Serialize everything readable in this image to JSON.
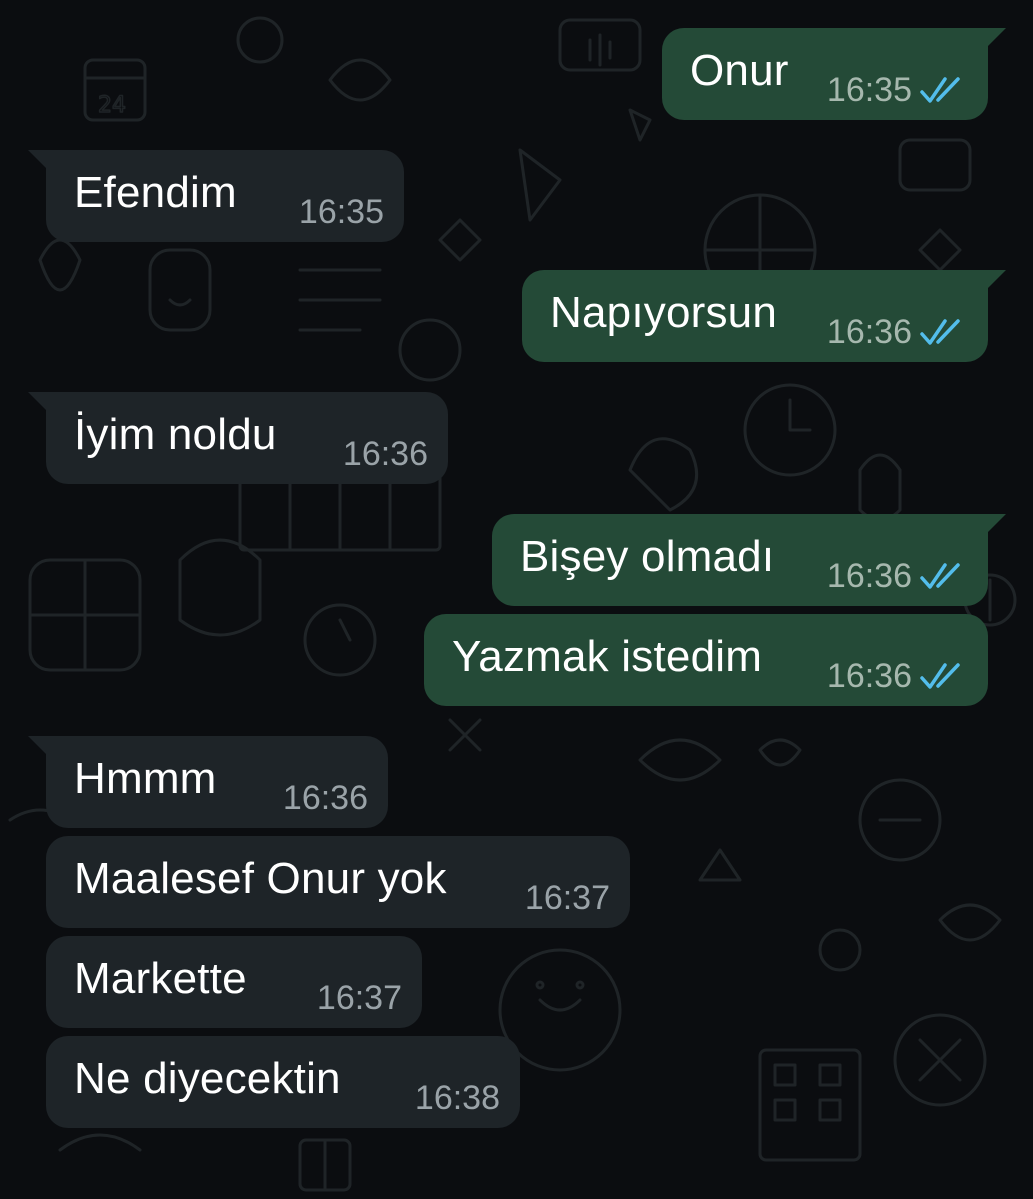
{
  "colors": {
    "background": "#0b0d10",
    "outgoing_bubble": "#244a37",
    "incoming_bubble": "#1e2428",
    "read_check": "#53bdeb",
    "timestamp": "#9aa3a8"
  },
  "messages": [
    {
      "direction": "outgoing",
      "text": "Onur",
      "time": "16:35",
      "status": "read",
      "status_icon": "double-check-read-icon"
    },
    {
      "direction": "incoming",
      "text": "Efendim",
      "time": "16:35"
    },
    {
      "direction": "outgoing",
      "text": "Napıyorsun",
      "time": "16:36",
      "status": "read",
      "status_icon": "double-check-read-icon"
    },
    {
      "direction": "incoming",
      "text": "İyim noldu",
      "time": "16:36"
    },
    {
      "direction": "outgoing",
      "text": "Bişey olmadı",
      "time": "16:36",
      "status": "read",
      "status_icon": "double-check-read-icon"
    },
    {
      "direction": "outgoing",
      "text": "Yazmak istedim",
      "time": "16:36",
      "status": "read",
      "status_icon": "double-check-read-icon"
    },
    {
      "direction": "incoming",
      "text": "Hmmm",
      "time": "16:36"
    },
    {
      "direction": "incoming",
      "text": "Maalesef Onur yok",
      "time": "16:37"
    },
    {
      "direction": "incoming",
      "text": "Markette",
      "time": "16:37"
    },
    {
      "direction": "incoming",
      "text": "Ne diyecektin",
      "time": "16:38"
    }
  ]
}
